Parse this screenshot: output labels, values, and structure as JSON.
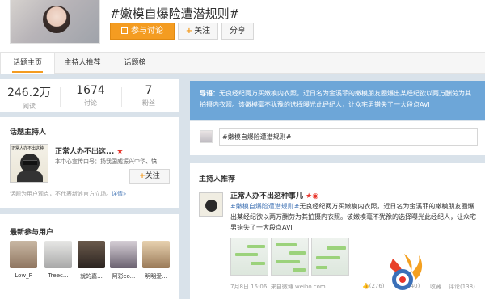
{
  "header": {
    "topic_title": "#嫩模自爆险遭潜规则#",
    "join_label": "参与讨论",
    "follow_label": "关注",
    "share_label": "分享"
  },
  "tabs": [
    "话题主页",
    "主持人推荐",
    "话题榜"
  ],
  "stats": [
    {
      "value": "246.2万",
      "label": "阅读"
    },
    {
      "value": "1674",
      "label": "讨论"
    },
    {
      "value": "7",
      "label": "粉丝"
    }
  ],
  "host_panel": {
    "title": "话题主持人",
    "image_caption": "正常人办不出这种",
    "name": "正常人办不出这...",
    "desc": "本中心宣传口号：扬我国威振兴中华、犒",
    "follow_label": "关注",
    "note": "话题为用户观点，不代表新浪官方立场。",
    "note_link": "详情»"
  },
  "users_panel": {
    "title": "最新参与用户",
    "users": [
      "Low_F",
      "Treec...",
      "就的嘉...",
      "阿彩co...",
      "明明爱..."
    ]
  },
  "intro": {
    "label": "导语：",
    "text": "无良经纪两万买嫩模内衣照，近日名为金溪菲的嫩模朋友圈爆出某经纪欲以两万酬劳为其拍摄内衣照。该嫩模毫不犹豫的选择曝光此经纪人，让众宅男错失了一大段点AVI"
  },
  "compose": {
    "text": "#嫩模自爆险遭潜规则#"
  },
  "recommend": {
    "title": "主持人推荐",
    "name": "正常人办不出这种事儿",
    "tag": "#嫩模自爆险遭潜规则#",
    "text": "无良经纪两万买嫩模内衣照，近日名为金溪菲的嫩模朋友圈爆出某经纪欲以两万酬劳为其拍摄内衣照。该嫩模毫不犹豫的选择曝光此经纪人，让众宅男错失了一大段点AVI",
    "time": "7月8日 15:06",
    "source": "来自微博 weibo.com",
    "likes": "(276)",
    "reposts": "(40)",
    "fav": "收藏",
    "comments": "评论(138)"
  },
  "colors": {
    "accent": "#f49c21",
    "intro_bg": "#6da6d8",
    "link": "#4a7ab8",
    "page_bg": "#d9e2ea"
  }
}
